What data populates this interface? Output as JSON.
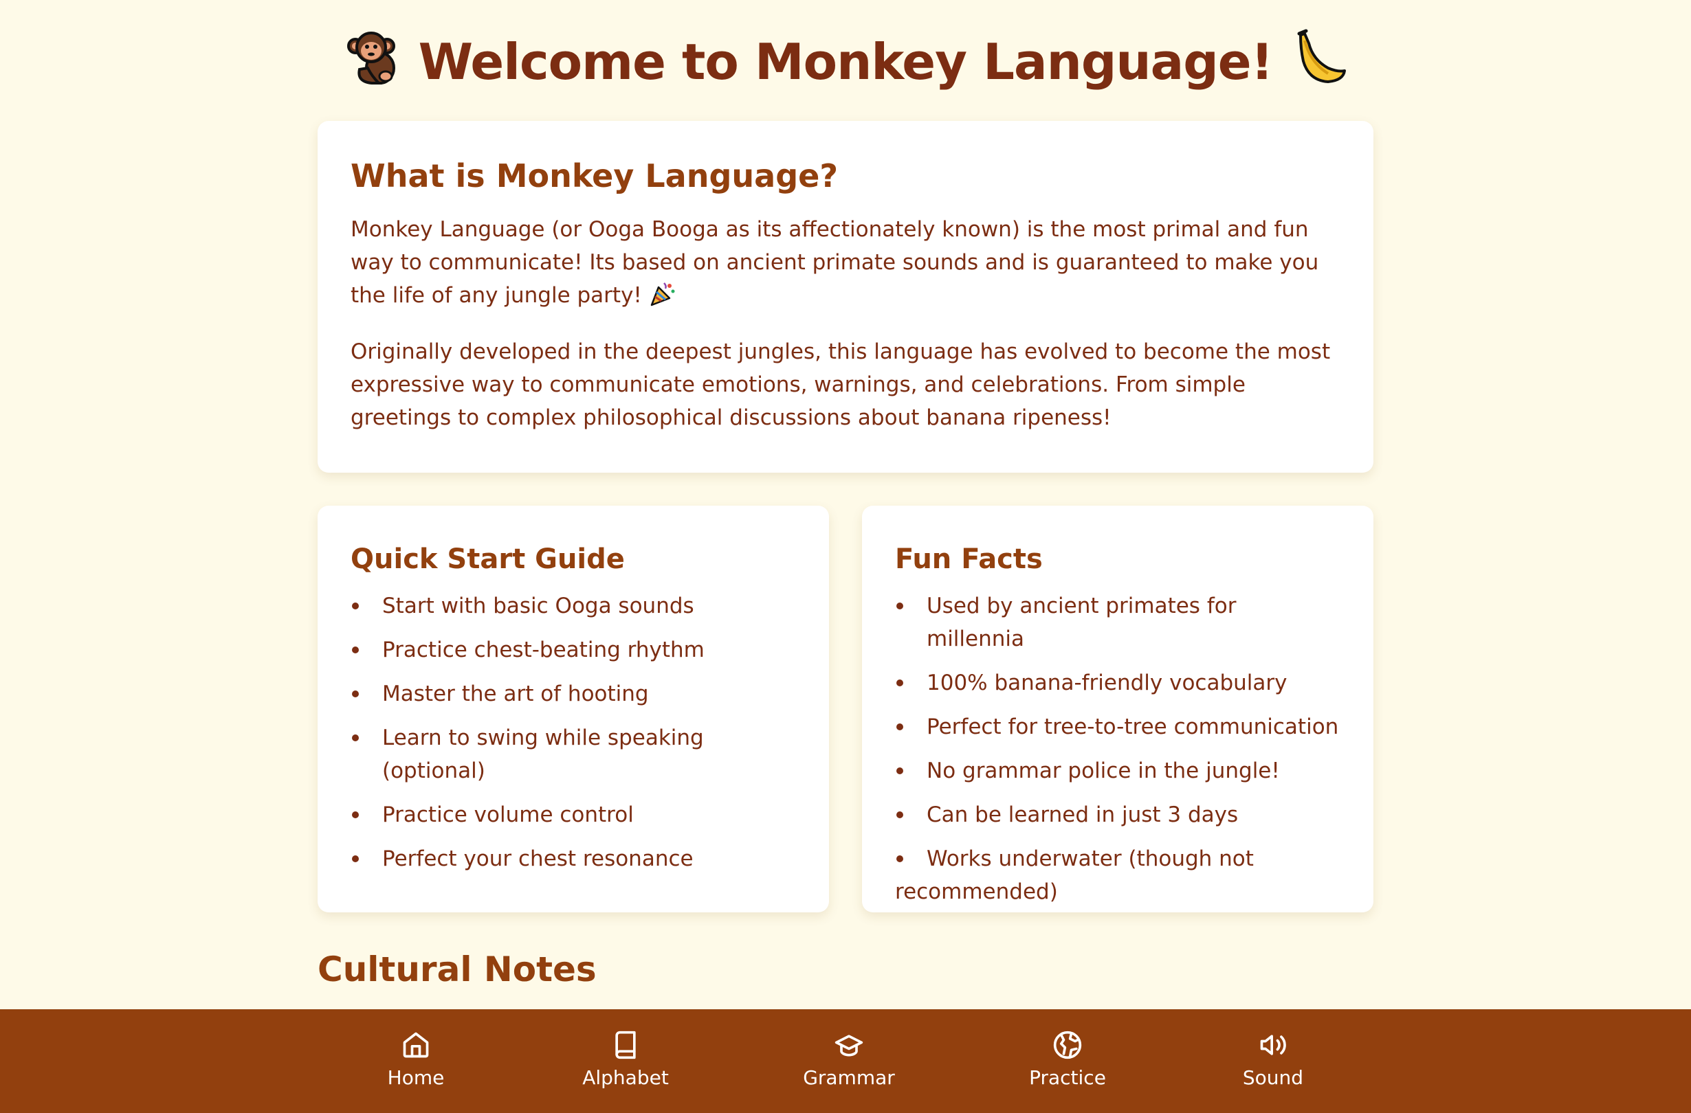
{
  "header": {
    "title": "Welcome to Monkey Language!",
    "left_emoji": "monkey-emoji",
    "right_emoji": "banana-emoji"
  },
  "intro": {
    "heading": "What is Monkey Language?",
    "paragraph1": "Monkey Language (or Ooga Booga as its affectionately known) is the most primal and fun way to communicate! Its based on ancient primate sounds and is guaranteed to make you the life of any jungle party!",
    "paragraph1_emoji": "party-popper-emoji",
    "paragraph2": "Originally developed in the deepest jungles, this language has evolved to become the most expressive way to communicate emotions, warnings, and celebrations. From simple greetings to complex philosophical discussions about banana ripeness!"
  },
  "quick_start": {
    "heading": "Quick Start Guide",
    "items": [
      "Start with basic Ooga sounds",
      "Practice chest-beating rhythm",
      "Master the art of hooting",
      "Learn to swing while speaking (optional)",
      "Practice volume control",
      "Perfect your chest resonance"
    ]
  },
  "fun_facts": {
    "heading": "Fun Facts",
    "items": [
      "Used by ancient primates for millennia",
      "100% banana-friendly vocabulary",
      "Perfect for tree-to-tree communication",
      "No grammar police in the jungle!",
      "Can be learned in just 3 days",
      "Works underwater (though not recommended)"
    ]
  },
  "cultural_notes": {
    "heading": "Cultural Notes"
  },
  "nav": {
    "items": [
      {
        "label": "Home",
        "icon": "home-icon"
      },
      {
        "label": "Alphabet",
        "icon": "book-icon"
      },
      {
        "label": "Grammar",
        "icon": "graduation-cap-icon"
      },
      {
        "label": "Practice",
        "icon": "globe-icon"
      },
      {
        "label": "Sound",
        "icon": "speaker-icon"
      }
    ]
  },
  "colors": {
    "background": "#fefae8",
    "text": "#7c2d12",
    "heading": "#92400e",
    "navbar": "#92400e",
    "card": "#ffffff"
  }
}
